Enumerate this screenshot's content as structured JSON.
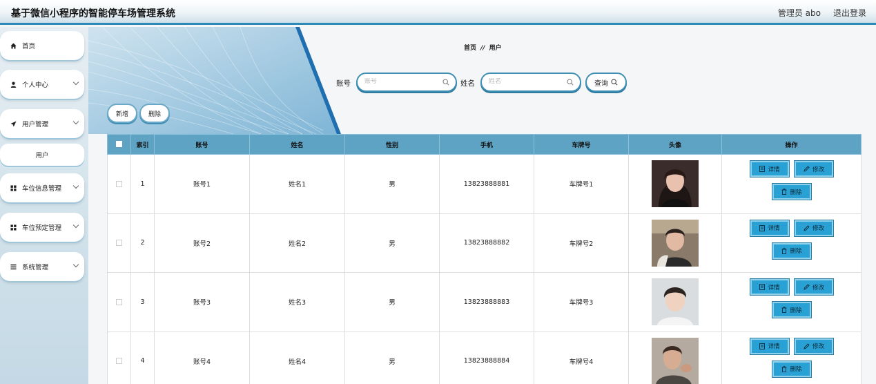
{
  "header": {
    "title": "基于微信小程序的智能停车场管理系统",
    "admin": "管理员 abo",
    "logout": "退出登录"
  },
  "sidebar": {
    "items": [
      {
        "label": "首页",
        "icon": "home-icon"
      },
      {
        "label": "个人中心",
        "icon": "user-icon"
      },
      {
        "label": "用户管理",
        "icon": "send-icon"
      },
      {
        "label": "用户",
        "icon": ""
      },
      {
        "label": "车位信息管理",
        "icon": "grid-icon"
      },
      {
        "label": "车位预定管理",
        "icon": "grid-icon"
      },
      {
        "label": "系统管理",
        "icon": "menu-icon"
      }
    ]
  },
  "breadcrumb": {
    "home": "首页",
    "sep": "//",
    "current": "用户"
  },
  "search": {
    "account_label": "账号",
    "account_placeholder": "账号",
    "name_label": "姓名",
    "name_placeholder": "姓名",
    "query_label": "查询"
  },
  "actions": {
    "add": "新增",
    "delete": "删除"
  },
  "table": {
    "columns": [
      "索引",
      "账号",
      "姓名",
      "性别",
      "手机",
      "车牌号",
      "头像",
      "操作"
    ],
    "rows": [
      {
        "index": "1",
        "account": "账号1",
        "name": "姓名1",
        "gender": "男",
        "phone": "13823888881",
        "plate": "车牌号1"
      },
      {
        "index": "2",
        "account": "账号2",
        "name": "姓名2",
        "gender": "男",
        "phone": "13823888882",
        "plate": "车牌号2"
      },
      {
        "index": "3",
        "account": "账号3",
        "name": "姓名3",
        "gender": "男",
        "phone": "13823888883",
        "plate": "车牌号3"
      },
      {
        "index": "4",
        "account": "账号4",
        "name": "姓名4",
        "gender": "男",
        "phone": "13823888884",
        "plate": "车牌号4"
      }
    ],
    "op_detail": "详情",
    "op_edit": "修改",
    "op_delete": "删除"
  },
  "colors": {
    "accent": "#2b8ab8",
    "header_row": "#5ea3c4",
    "op_button": "#2aa1d4"
  }
}
